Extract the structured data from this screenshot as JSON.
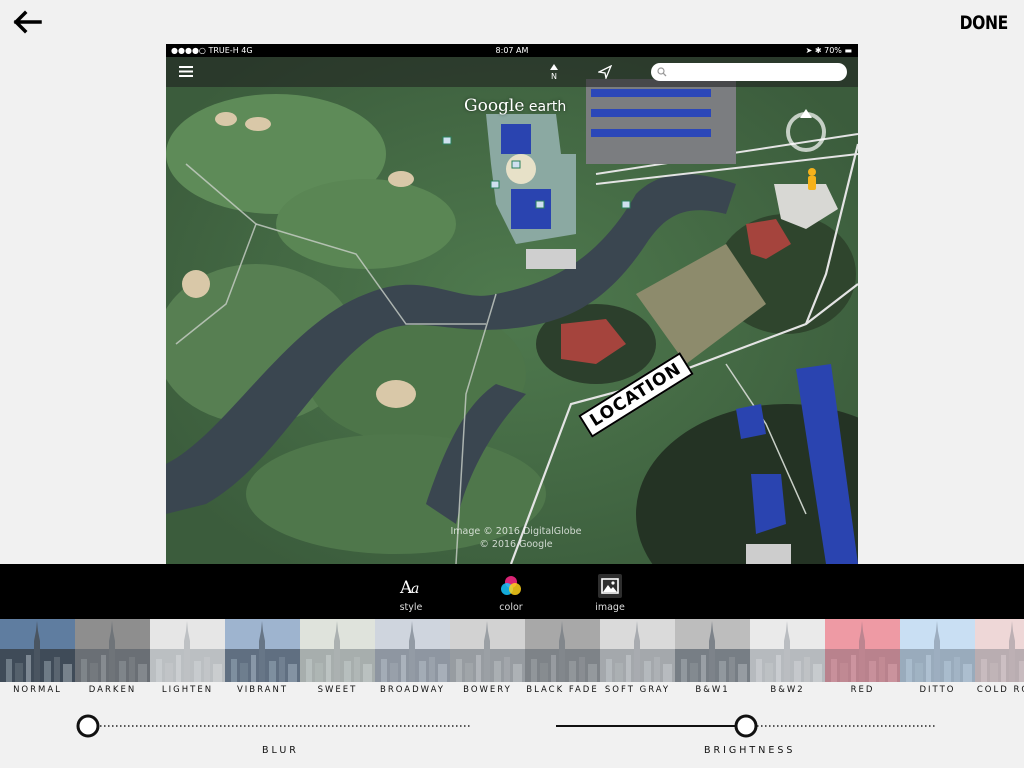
{
  "header": {
    "done_label": "DONE"
  },
  "status_bar": {
    "left": "●●●●○ TRUE-H  4G",
    "time": "8:07 AM",
    "right": "➤ ✱ 70% ▬"
  },
  "map": {
    "search_placeholder": "",
    "brand_main": "Google",
    "brand_sub": " earth",
    "credit_line1": "Image © 2016 DigitalGlobe",
    "credit_line2": "© 2016 Google",
    "sticker_text": "LOCATION"
  },
  "tools": [
    {
      "label": "style",
      "icon": "text-style-icon"
    },
    {
      "label": "color",
      "icon": "color-wheel-icon"
    },
    {
      "label": "image",
      "icon": "image-icon"
    }
  ],
  "filters": [
    {
      "label": "NORMAL",
      "tint": "#5f7da0",
      "fade": 0.0
    },
    {
      "label": "DARKEN",
      "tint": "#8e8e8e",
      "fade": 0.55
    },
    {
      "label": "LIGHTEN",
      "tint": "#e6e6e6",
      "fade": 0.75
    },
    {
      "label": "VIBRANT",
      "tint": "#9fb4cf",
      "fade": 0.35
    },
    {
      "label": "SWEET",
      "tint": "#dfe3dc",
      "fade": 0.65
    },
    {
      "label": "BROADWAY",
      "tint": "#cfd6de",
      "fade": 0.55
    },
    {
      "label": "BOWERY",
      "tint": "#d2d2d2",
      "fade": 0.6
    },
    {
      "label": "BLACK FADE",
      "tint": "#a8a8a8",
      "fade": 0.6
    },
    {
      "label": "SOFT GRAY",
      "tint": "#dadada",
      "fade": 0.65
    },
    {
      "label": "B&W1",
      "tint": "#bdbdbd",
      "fade": 0.45
    },
    {
      "label": "B&W2",
      "tint": "#eaeaea",
      "fade": 0.7
    },
    {
      "label": "RED",
      "tint": "#ee9aa4",
      "fade": 0.7
    },
    {
      "label": "DITTO",
      "tint": "#c9dff2",
      "fade": 0.65
    },
    {
      "label": "COLD ROOM",
      "tint": "#eed7d7",
      "fade": 0.7
    }
  ],
  "sliders": [
    {
      "label": "BLUR",
      "value": 0.0
    },
    {
      "label": "BRIGHTNESS",
      "value": 0.5
    }
  ]
}
